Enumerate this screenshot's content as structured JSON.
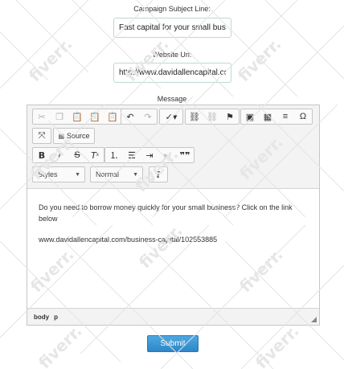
{
  "subject": {
    "label": "Campaign Subject Line:",
    "value": "Fast capital for your small business"
  },
  "website": {
    "label": "Website Url:",
    "value": "http://www.davidallencapital.com"
  },
  "message": {
    "label": "Message",
    "toolbar": {
      "source_label": "Source",
      "styles_label": "Styles",
      "format_label": "Normal",
      "help_label": "?"
    },
    "body_paragraph": "Do you need to borrow money quickly for your small business? Click on the link below",
    "body_link": "www.davidallencapital.com/business-capital/102553885",
    "path_body": "body",
    "path_p": "p"
  },
  "submit_label": "Submit",
  "watermark_text": "fiverr.",
  "colors": {
    "input_border": "#bcd9d6",
    "submit_bg": "#3a95d3",
    "toolbar_bg": "#f3f3f3"
  }
}
